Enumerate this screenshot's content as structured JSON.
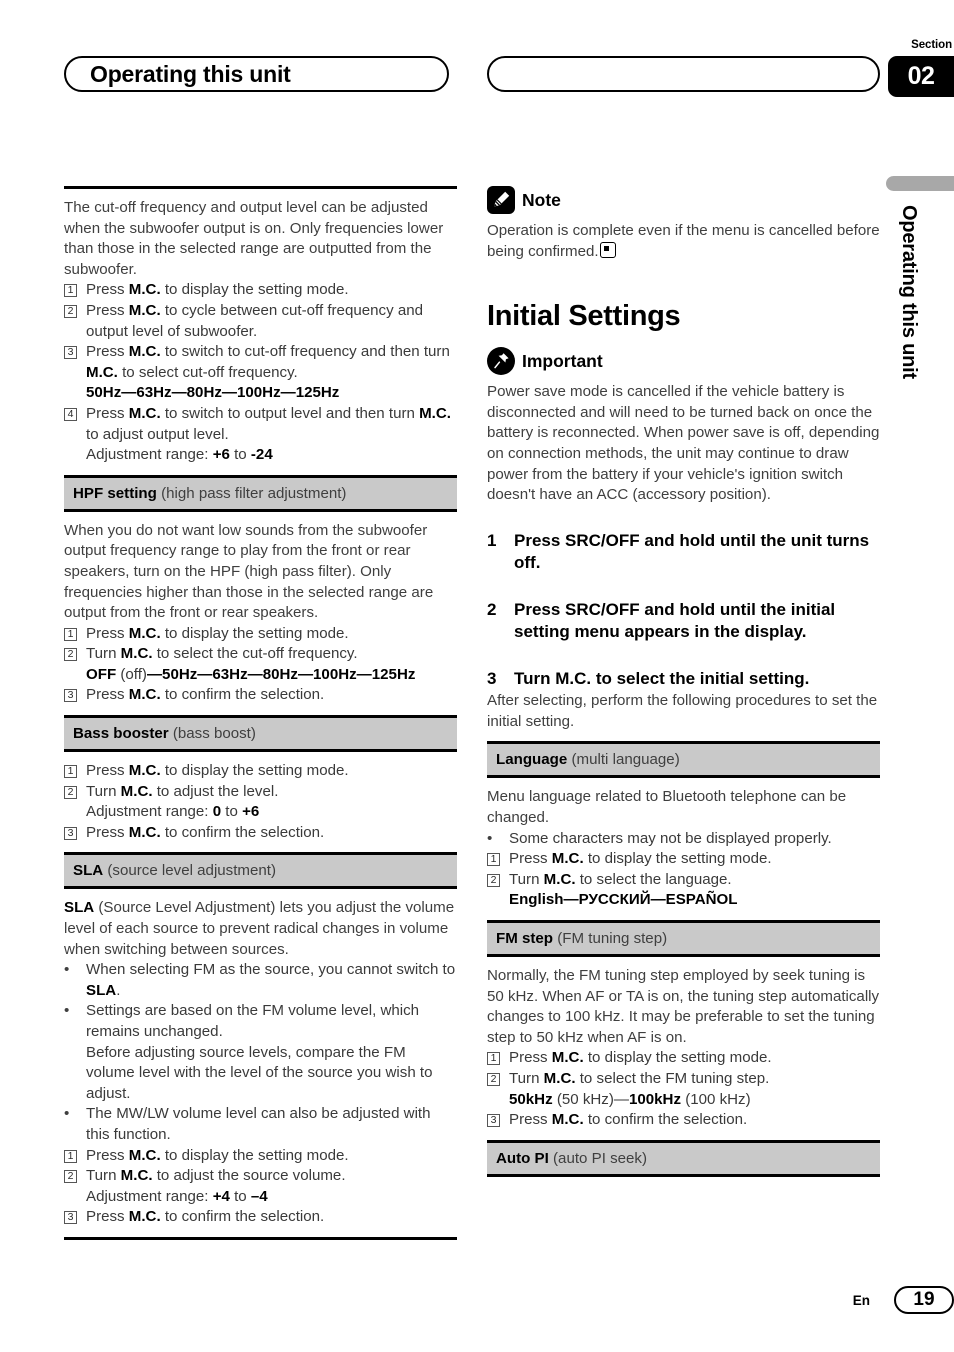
{
  "header": {
    "title": "Operating this unit",
    "section_label": "Section",
    "section_number": "02"
  },
  "side_tab": {
    "vertical_text": "Operating this unit"
  },
  "left_column": {
    "intro": {
      "lines": [
        "The cut-off frequency and output level can be ad-",
        "justed when the subwoofer output is on.",
        "Only frequencies lower than those in the selected",
        "range are outputted from the subwoofer."
      ],
      "text": "The cut-off frequency and output level can be adjusted when the subwoofer output is on. Only frequencies lower than those in the selected range are outputted from the subwoofer."
    },
    "intro_steps": [
      {
        "num": "1",
        "pre": "Press ",
        "bold": "M.C.",
        "post": " to display the setting mode.",
        "cont": null
      },
      {
        "num": "2",
        "pre": "Press ",
        "bold": "M.C.",
        "post": " to cycle between cut-off frequency and output level of subwoofer.",
        "cont": null
      },
      {
        "num": "3",
        "pre": "Press ",
        "bold": "M.C.",
        "post": " to switch to cut-off frequency and then turn ",
        "bold2": "M.C.",
        "post2": " to select cut-off frequency.",
        "cont": "50Hz—63Hz—80Hz—100Hz—125Hz"
      },
      {
        "num": "4",
        "pre": "Press ",
        "bold": "M.C.",
        "post": " to switch to output level and then turn ",
        "bold2": "M.C.",
        "post2": " to adjust output level.",
        "cont_label": "Adjustment range: ",
        "cont_a": "+6",
        "cont_mid": " to ",
        "cont_b": "-24"
      }
    ],
    "sections": [
      {
        "name": "HPF setting",
        "desc": "(high pass filter adjustment)",
        "body": "When you do not want low sounds from the subwoofer output frequency range to play from the front or rear speakers, turn on the HPF (high pass filter). Only frequencies higher than those in the selected range are output from the front or rear speakers.",
        "steps": [
          {
            "num": "1",
            "pre": "Press ",
            "bold": "M.C.",
            "post": " to display the setting mode."
          },
          {
            "num": "2",
            "pre": "Turn ",
            "bold": "M.C.",
            "post": " to select the cut-off frequency."
          },
          {
            "num": "3",
            "pre": "Press ",
            "bold": "M.C.",
            "post": " to confirm the selection."
          }
        ],
        "options_bold_1": "OFF",
        "options_plain_1": " (off)",
        "options_bold_2": "—50Hz—63Hz—80Hz—100Hz—125Hz"
      },
      {
        "name": "Bass booster",
        "desc": "(bass boost)",
        "steps": [
          {
            "num": "1",
            "pre": "Press ",
            "bold": "M.C.",
            "post": " to display the setting mode."
          },
          {
            "num": "2",
            "pre": "Turn ",
            "bold": "M.C.",
            "post": " to adjust the level."
          },
          {
            "num": "3",
            "pre": "Press ",
            "bold": "M.C.",
            "post": " to confirm the selection."
          }
        ],
        "range_label": "Adjustment range: ",
        "range_a": "0",
        "range_mid": " to ",
        "range_b": "+6"
      },
      {
        "name": "SLA",
        "desc": "(source level adjustment)",
        "body_bold": "SLA",
        "body": " (Source Level Adjustment) lets you adjust the volume level of each source to prevent radical changes in volume when switching between sources.",
        "bullets": [
          {
            "pre": "When selecting FM as the source, you cannot switch to ",
            "bold": "SLA",
            "post": "."
          },
          {
            "pre": "Settings are based on the FM volume level, which remains unchanged.",
            "bold": "",
            "post": ""
          },
          {
            "pre": "The MW/LW volume level can also be adjusted with this function.",
            "bold": "",
            "post": ""
          }
        ],
        "bullet2_cont": "Before adjusting source levels, compare the FM volume level with the level of the source you wish to adjust.",
        "steps": [
          {
            "num": "1",
            "pre": "Press ",
            "bold": "M.C.",
            "post": " to display the setting mode."
          },
          {
            "num": "2",
            "pre": "Turn ",
            "bold": "M.C.",
            "post": " to adjust the source volume."
          },
          {
            "num": "3",
            "pre": "Press ",
            "bold": "M.C.",
            "post": " to confirm the selection."
          }
        ],
        "range_label": "Adjustment range: ",
        "range_a": "+4",
        "range_mid": " to ",
        "range_b": "–4"
      }
    ]
  },
  "right_column": {
    "note": {
      "heading": "Note",
      "icon": "pencil-icon",
      "text": "Operation is complete even if the menu is cancelled before being confirmed."
    },
    "heading": "Initial Settings",
    "important": {
      "heading": "Important",
      "icon": "pushpin-icon",
      "text": "Power save mode is cancelled if the vehicle battery is disconnected and will need to be turned back on once the battery is reconnected. When power save is off, depending on connection methods, the unit may continue to draw power from the battery if your vehicle's ignition switch doesn't have an ACC (accessory position)."
    },
    "procedures": [
      {
        "num": "1",
        "text": "Press SRC/OFF and hold until the unit turns off.",
        "sub": null
      },
      {
        "num": "2",
        "text": "Press SRC/OFF and hold until the initial setting menu appears in the display.",
        "sub": null
      },
      {
        "num": "3",
        "text": "Turn M.C. to select the initial setting.",
        "sub": "After selecting, perform the following procedures to set the initial setting."
      }
    ],
    "sections": [
      {
        "name": "Language",
        "desc": "(multi language)",
        "body": "Menu language related to Bluetooth telephone can be changed.",
        "bullets": [
          "Some characters may not be displayed properly."
        ],
        "steps": [
          {
            "num": "1",
            "pre": "Press ",
            "bold": "M.C.",
            "post": " to display the setting mode."
          },
          {
            "num": "2",
            "pre": "Turn ",
            "bold": "M.C.",
            "post": " to select the language."
          }
        ],
        "options": "English—РУССКИЙ—ESPAÑOL"
      },
      {
        "name": "FM step",
        "desc": "(FM tuning step)",
        "body": "Normally, the FM tuning step employed by seek tuning is 50 kHz. When AF or TA is on, the tuning step automatically changes to 100 kHz. It may be preferable to set the tuning step to 50 kHz when AF is on.",
        "steps": [
          {
            "num": "1",
            "pre": "Press ",
            "bold": "M.C.",
            "post": " to display the setting mode."
          },
          {
            "num": "2",
            "pre": "Turn ",
            "bold": "M.C.",
            "post": " to select the FM tuning step."
          },
          {
            "num": "3",
            "pre": "Press ",
            "bold": "M.C.",
            "post": " to confirm the selection."
          }
        ],
        "opt_bold_1": "50kHz",
        "opt_plain_1": " (50 kHz)—",
        "opt_bold_2": "100kHz",
        "opt_plain_2": " (100 kHz)"
      },
      {
        "name": "Auto PI",
        "desc": "(auto PI seek)"
      }
    ]
  },
  "footer": {
    "language_code": "En",
    "page_number": "19"
  }
}
